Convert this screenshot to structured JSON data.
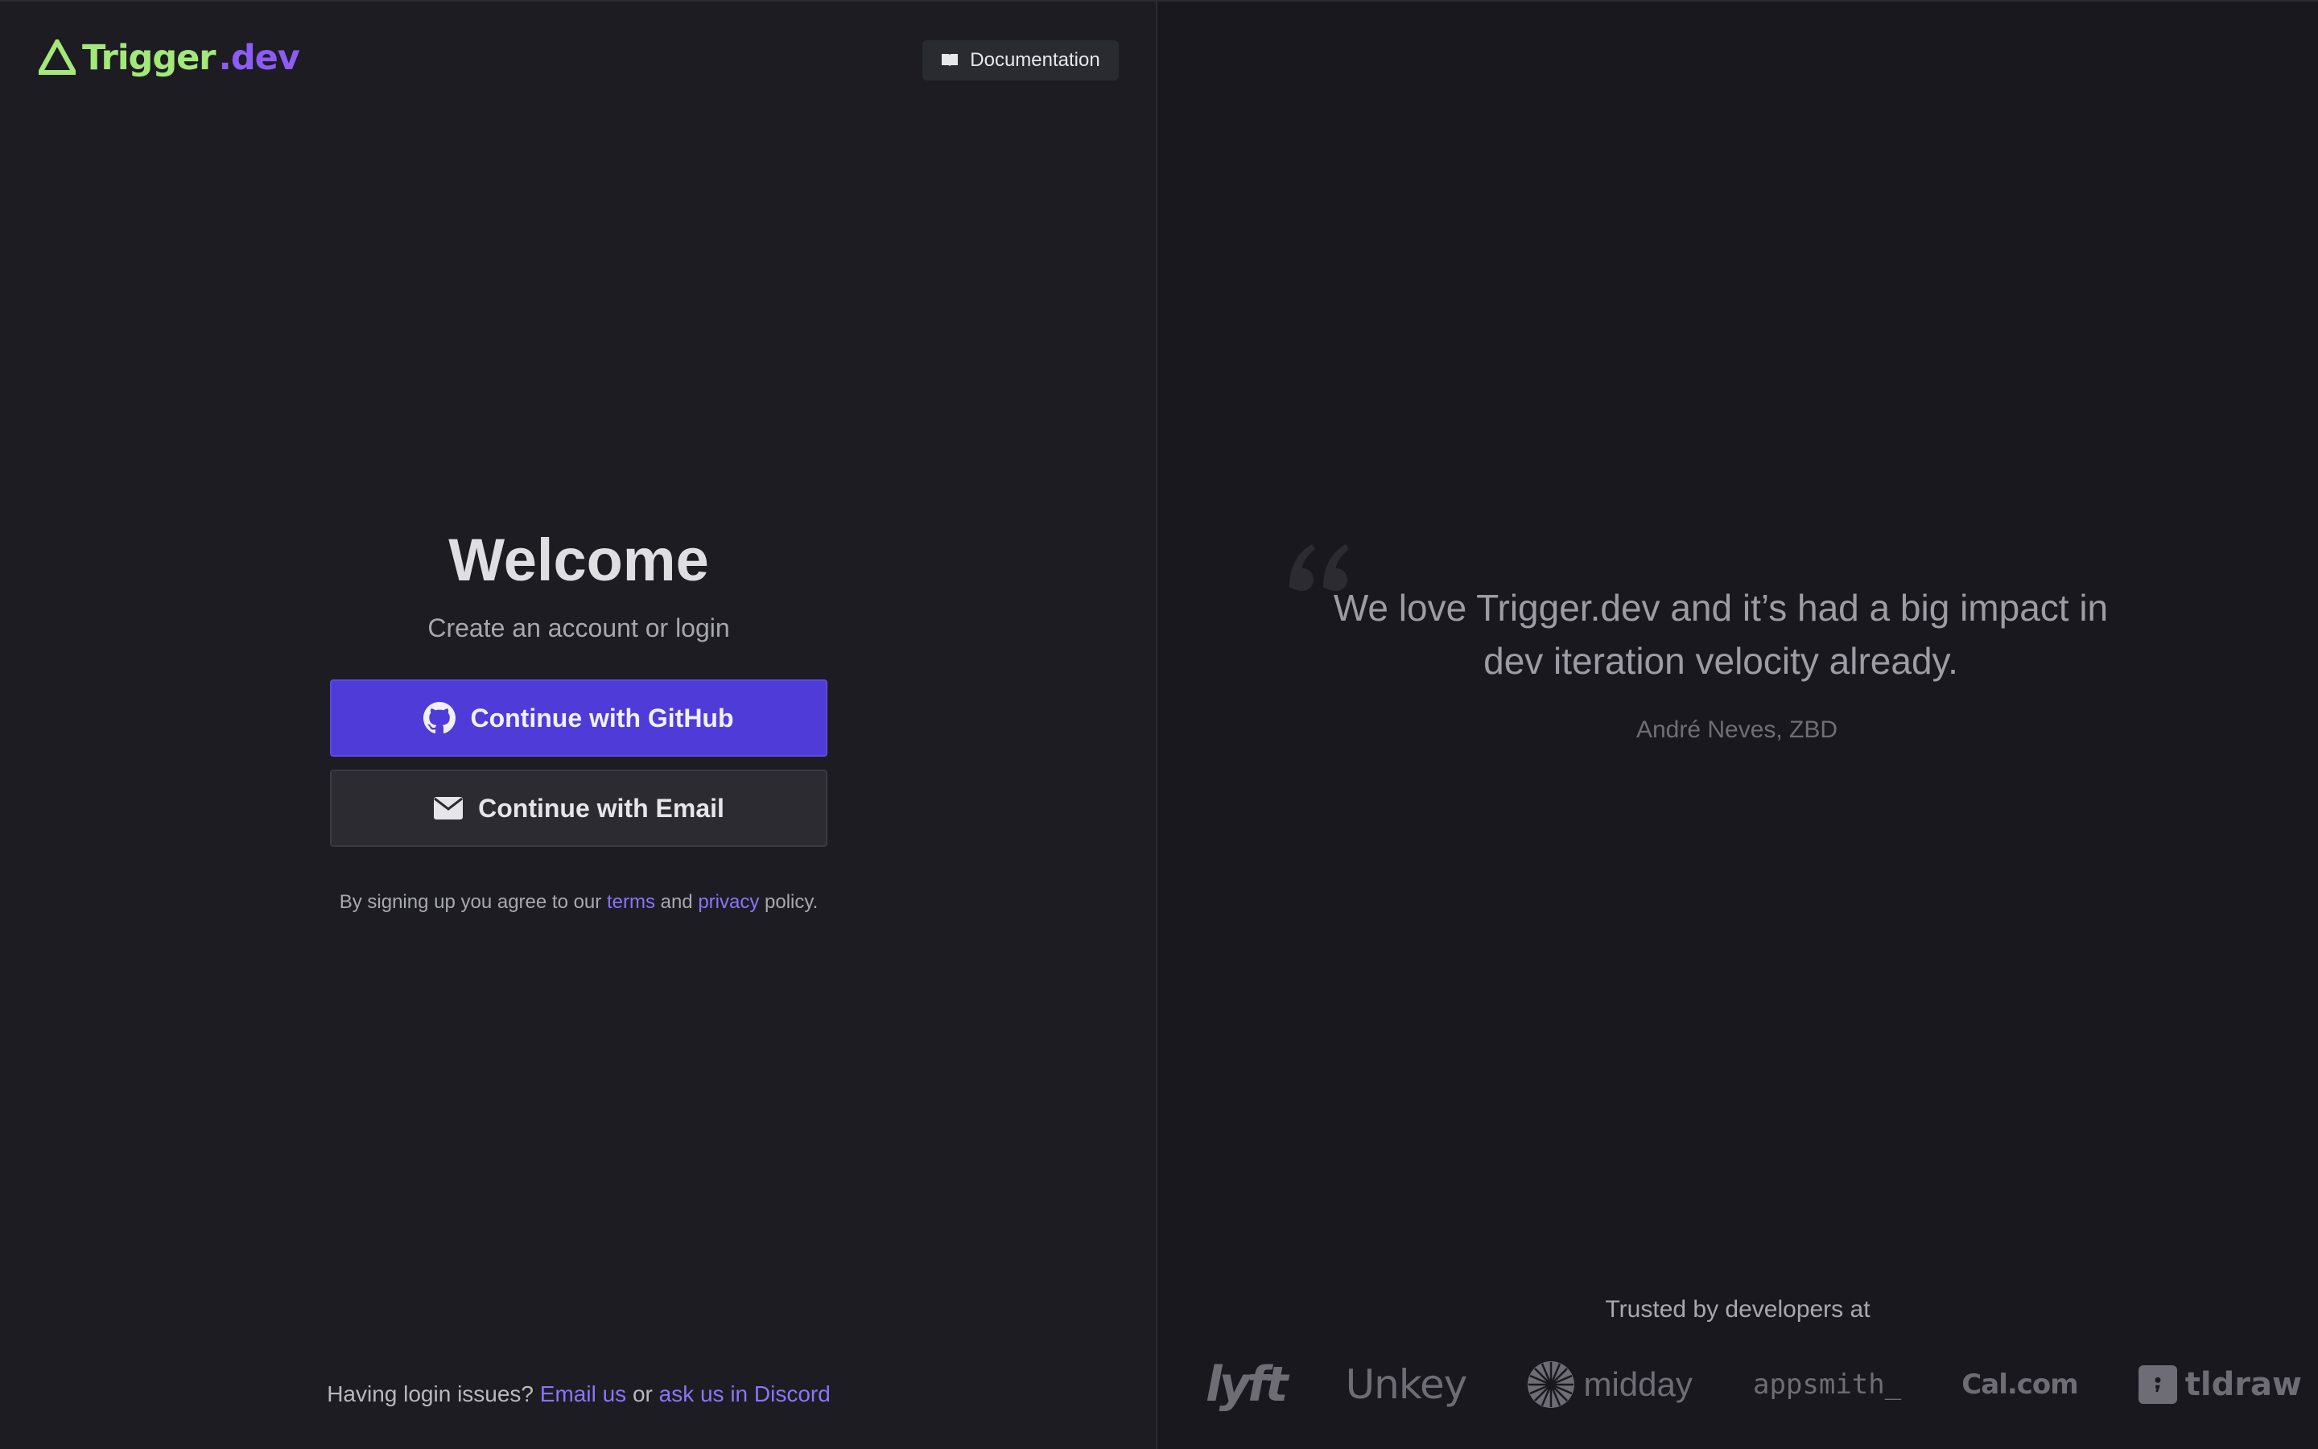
{
  "header": {
    "logo_word": "Trigger",
    "logo_suffix": ".dev",
    "docs_label": "Documentation"
  },
  "auth": {
    "title": "Welcome",
    "subtitle": "Create an account or login",
    "github_label": "Continue with GitHub",
    "email_label": "Continue with Email",
    "legal_prefix": "By signing up you agree to our",
    "terms_link": "terms",
    "legal_and": "and",
    "privacy_link": "privacy",
    "legal_suffix": "policy."
  },
  "footer": {
    "issues_prefix": "Having login issues?",
    "email_link": "Email us",
    "or": "or",
    "discord_link": "ask us in Discord"
  },
  "testimonial": {
    "quote": "We love Trigger.dev and it’s had a big impact in dev iteration velocity already.",
    "author": "André Neves, ZBD"
  },
  "trusted": {
    "title": "Trusted by developers at",
    "logos": [
      "lyft",
      "Unkey",
      "midday",
      "appsmith_",
      "Cal.com",
      "tldraw"
    ]
  },
  "colors": {
    "brand_green": "#a3e879",
    "brand_purple": "#8b5cf6",
    "primary_button": "#4f3bd7",
    "link": "#8b74f8"
  },
  "icons": [
    "trigger-logo-icon",
    "book-icon",
    "github-icon",
    "mail-icon",
    "quote-icon",
    "midday-logo-icon",
    "tldraw-logo-icon"
  ]
}
